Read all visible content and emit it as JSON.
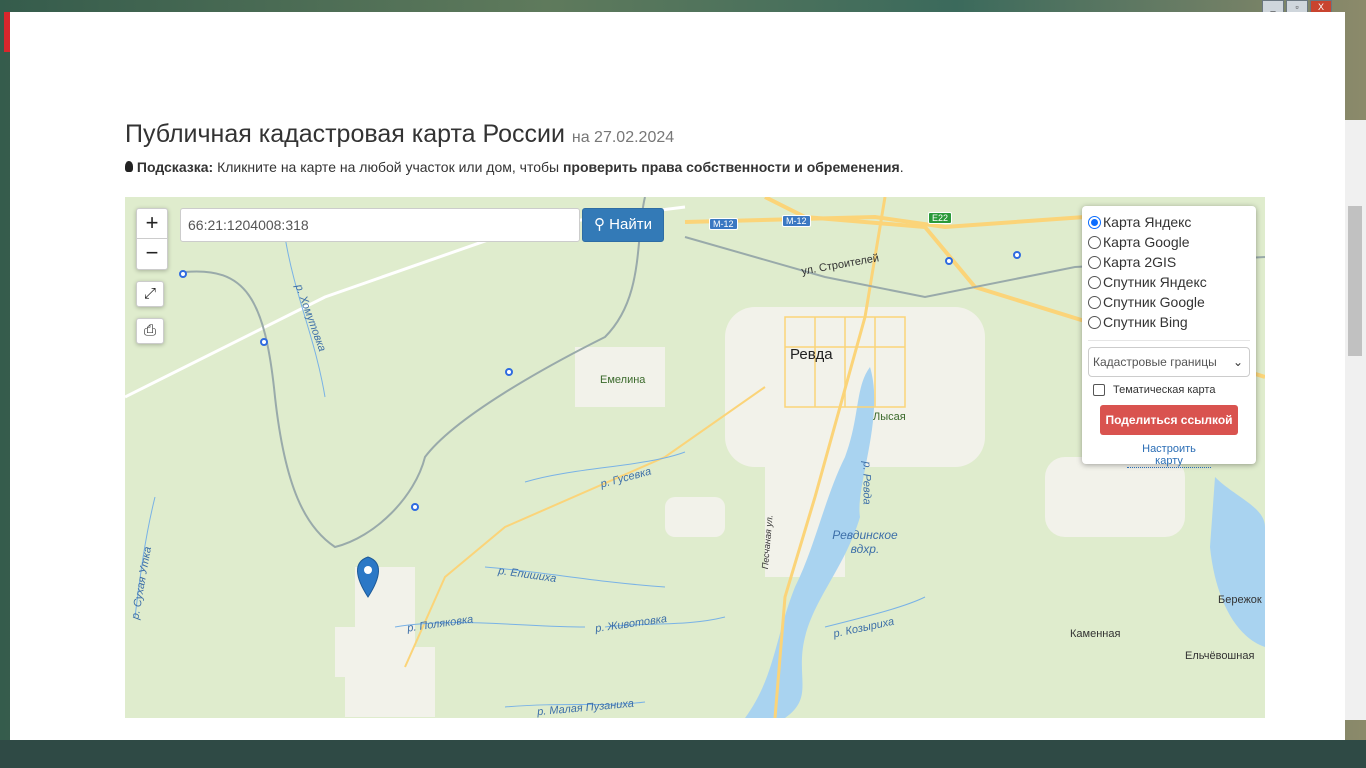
{
  "window": {
    "close_glyph": "X",
    "restore_glyph": "▫",
    "minimize_glyph": "_"
  },
  "header": {
    "title": "Публичная кадастровая карта России",
    "date": "на 27.02.2024"
  },
  "hint": {
    "label": "Подсказка:",
    "text": " Кликните на карте на любой участок или дом, чтобы ",
    "bold": "проверить права собственности и обременения",
    "end": "."
  },
  "map": {
    "zoom_in": "+",
    "zoom_out": "−",
    "fullscreen_icon": "⤢",
    "print_icon": "⎙",
    "search_value": "66:21:1204008:318",
    "search_button": "Найти",
    "colors": {
      "accent": "#337ab7",
      "share": "#d9534f",
      "water": "#a9d3f0",
      "forest": "#dfeccd"
    },
    "layers": [
      {
        "label": "Карта Яндекс",
        "selected": true
      },
      {
        "label": "Карта Google",
        "selected": false
      },
      {
        "label": "Карта 2GIS",
        "selected": false
      },
      {
        "label": "Спутник Яндекс",
        "selected": false
      },
      {
        "label": "Спутник Google",
        "selected": false
      },
      {
        "label": "Спутник Bing",
        "selected": false
      }
    ],
    "overlay_select": "Кадастровые границы",
    "thematic_label": "Тематическая карта",
    "thematic_checked": false,
    "share_button": "Поделиться ссылкой",
    "configure_link": "Настроить карту",
    "labels": {
      "city": "Ревда",
      "emelina": "Емелина",
      "lysaya": "Лысая",
      "gusevka": "р. Гусевка",
      "reservoir": "Ревдинское\nвдхр.",
      "revda_river": "р. Ревда",
      "peschanaya": "Песчаная ул.",
      "epishikha": "р. Епишиха",
      "polyakovka": "р. Поляковка",
      "zhivotovka": "р. Животовка",
      "kozyrikha": "р. Козыриха",
      "kamennaya": "Каменная",
      "elchevoshnaya": "Ельчёвошная",
      "berezhok": "Бережок",
      "puzanikha": "р. Малая Пузаниха",
      "sukhaya": "р. Сухая Утка",
      "khomutovka": "р. Хомутовка",
      "stroiteley": "ул. Строителей",
      "m12a": "M-12",
      "m12b": "M-12",
      "e22": "E22"
    }
  }
}
